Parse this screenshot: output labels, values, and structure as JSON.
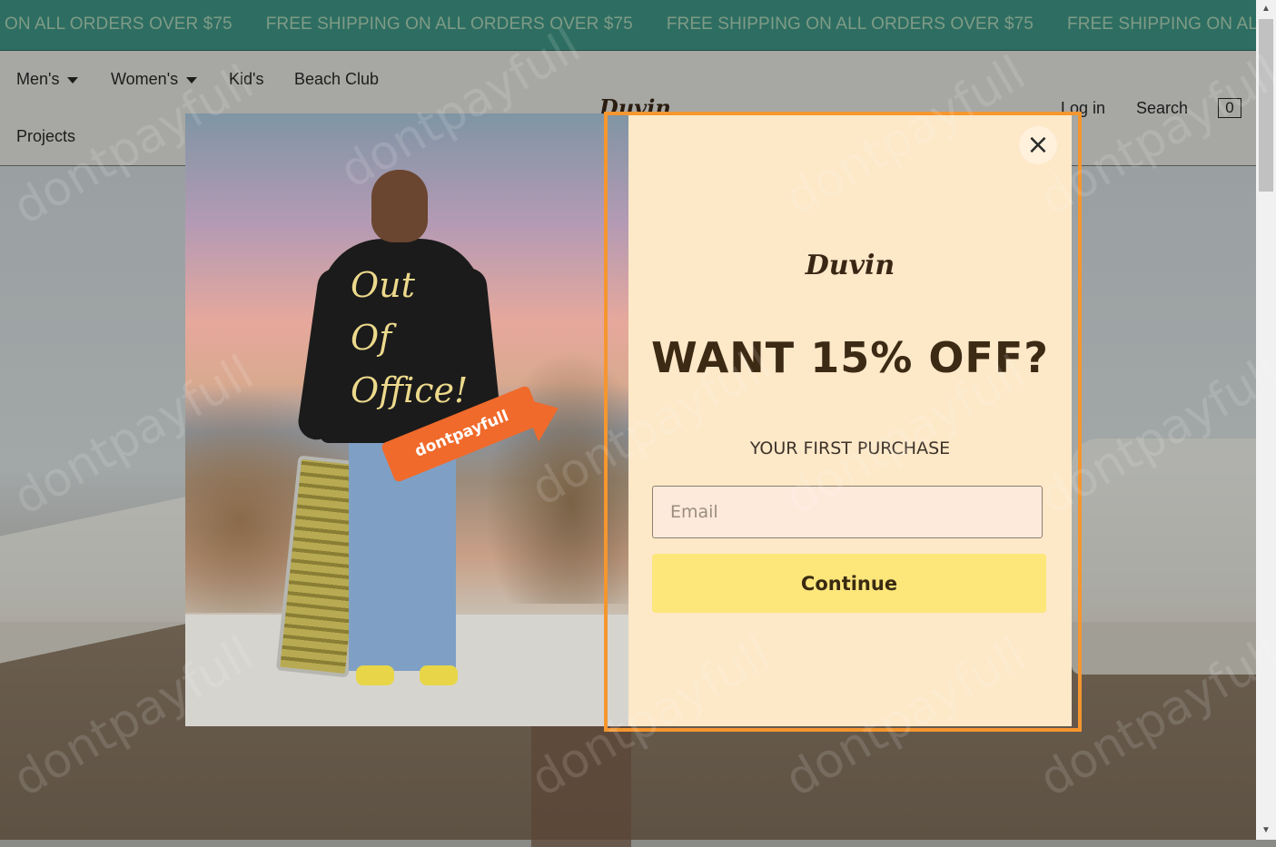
{
  "announcement": {
    "items": [
      "ON ALL ORDERS OVER $75",
      "FREE SHIPPING ON ALL ORDERS OVER $75",
      "FREE SHIPPING ON ALL ORDERS OVER $75",
      "FREE SHIPPING ON ALL ORDERS O"
    ]
  },
  "nav": {
    "mens": "Men's",
    "womens": "Women's",
    "kids": "Kid's",
    "beach_club": "Beach Club",
    "projects": "Projects",
    "login": "Log in",
    "search": "Search",
    "cart_count": "0",
    "logo": "Duvin"
  },
  "modal": {
    "sweater_line1": "Out Of",
    "sweater_line2": "Office!",
    "badge": "dontpayfull",
    "logo": "Duvin",
    "headline": "WANT 15% OFF?",
    "subline": "YOUR FIRST PURCHASE",
    "email_placeholder": "Email",
    "continue_label": "Continue",
    "close_symbol": "×"
  },
  "watermark": "dontpayfull",
  "colors": {
    "announce_bg": "#2e6e62",
    "form_bg": "#fde8c8",
    "button_bg": "#fde67a",
    "focus_ring": "#f5962f",
    "badge": "#f06a2b"
  }
}
